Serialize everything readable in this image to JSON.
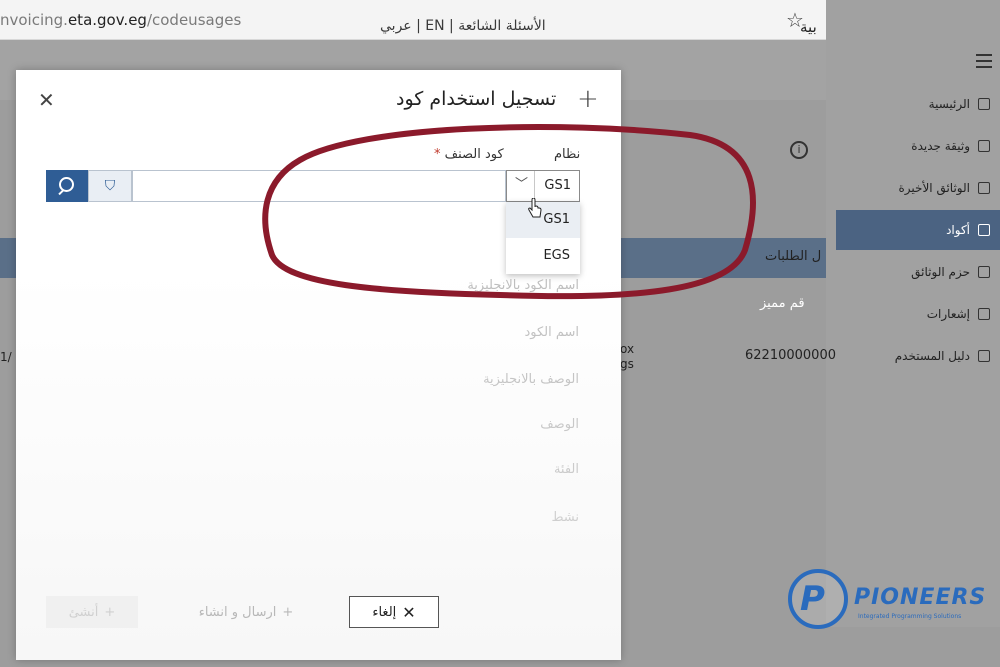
{
  "browser": {
    "url_prefix": "nvoicing.",
    "url_domain": "eta.gov.eg",
    "url_path": "/codeusages"
  },
  "background_page": {
    "header_links": "الأسئلة الشائعة  |  EN  |  عربي",
    "header_title": "بية",
    "info_icon_label": "i",
    "tab_text": "ل الطلبات",
    "table_header": "قم مميز",
    "cell_value": "62210000000",
    "cell_partial": "ox\ngs",
    "cell_left": "1/"
  },
  "sidebar": {
    "items": [
      {
        "label": "الرئيسية",
        "icon": "home-icon"
      },
      {
        "label": "وثيقة جديدة",
        "icon": "new-document-icon"
      },
      {
        "label": "الوثائق الأخيرة",
        "icon": "recent-documents-icon"
      },
      {
        "label": "أكواد",
        "icon": "codes-icon",
        "active": true
      },
      {
        "label": "حزم الوثائق",
        "icon": "download-icon"
      },
      {
        "label": "إشعارات",
        "icon": "notifications-icon"
      },
      {
        "label": "دليل المستخدم",
        "icon": "user-guide-icon"
      }
    ]
  },
  "modal": {
    "title": "تسجيل استخدام كود",
    "label_system": "نظام",
    "label_item_code": "كود الصنف",
    "required_mark": "*",
    "filter_icon": "⛉",
    "item_code_value": "",
    "system_selected": "GS1",
    "dropdown_options": [
      "GS1",
      "EGS"
    ],
    "fields": [
      "اسم الكود بالانجليزية",
      "اسم الكود",
      "الوصف بالانجليزية",
      "الوصف",
      "الفئة",
      "نشط"
    ],
    "buttons": {
      "cancel": "إلغاء",
      "send_and_create": "ارسال و انشاء",
      "save": "أنشئ"
    }
  },
  "watermark": {
    "brand": "PIONEERS",
    "tagline": "Integrated Programming Solutions"
  },
  "colors": {
    "primary_blue": "#2f5d95",
    "sidebar_active": "#4b6382",
    "annotation_red": "#8b1a2b"
  }
}
